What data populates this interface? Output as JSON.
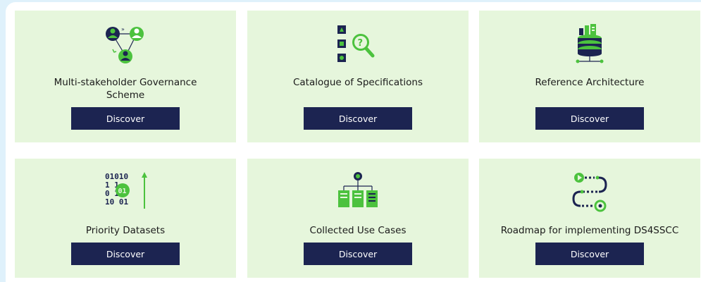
{
  "cards": [
    {
      "title": "Multi-stakeholder Governance Scheme",
      "title_line1": "Multi-stakeholder Governance",
      "title_line2": "Scheme",
      "button": "Discover",
      "icon": "stakeholders-icon"
    },
    {
      "title": "Catalogue of Specifications",
      "button": "Discover",
      "icon": "catalogue-search-icon"
    },
    {
      "title": "Reference Architecture",
      "button": "Discover",
      "icon": "architecture-database-icon"
    },
    {
      "title": "Priority Datasets",
      "button": "Discover",
      "icon": "binary-data-icon"
    },
    {
      "title": "Collected Use Cases",
      "button": "Discover",
      "icon": "use-cases-tree-icon"
    },
    {
      "title": "Roadmap for implementing DS4SSCC",
      "button": "Discover",
      "icon": "roadmap-path-icon"
    }
  ],
  "colors": {
    "card_bg": "#e6f6dc",
    "button_bg": "#1c2451",
    "accent_green": "#4cc23e",
    "icon_dark": "#1c2451"
  }
}
